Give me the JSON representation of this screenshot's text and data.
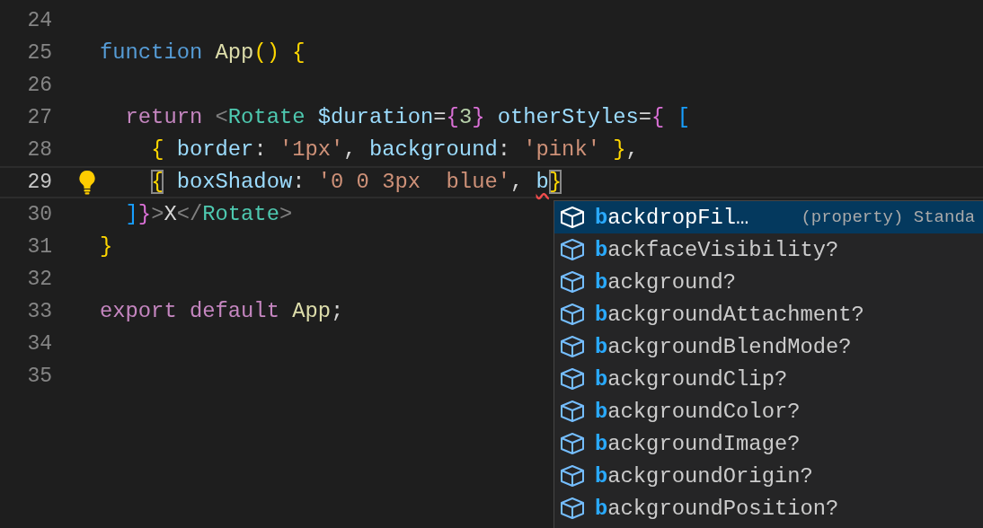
{
  "editor": {
    "lines": [
      {
        "number": "24",
        "current": false
      },
      {
        "number": "25",
        "current": false,
        "tokens": [
          {
            "kind": "keyword",
            "text": "function "
          },
          {
            "kind": "function",
            "text": "App"
          },
          {
            "kind": "bracket1",
            "text": "()"
          },
          {
            "kind": "bracket1",
            "text": " {"
          }
        ]
      },
      {
        "number": "26",
        "current": false
      },
      {
        "number": "27",
        "current": false,
        "tokens": [
          {
            "kind": "control",
            "text": "  return "
          },
          {
            "kind": "punct",
            "text": "<"
          },
          {
            "kind": "tag",
            "text": "Rotate"
          },
          {
            "kind": "attr",
            "text": " $duration"
          },
          {
            "kind": "plain",
            "text": "="
          },
          {
            "kind": "bracket2",
            "text": "{"
          },
          {
            "kind": "number",
            "text": "3"
          },
          {
            "kind": "bracket2",
            "text": "}"
          },
          {
            "kind": "attr",
            "text": " otherStyles"
          },
          {
            "kind": "plain",
            "text": "="
          },
          {
            "kind": "bracket2",
            "text": "{"
          },
          {
            "kind": "bracket3",
            "text": " ["
          }
        ]
      },
      {
        "number": "28",
        "current": false,
        "tokens": [
          {
            "kind": "bracket1",
            "text": "    {"
          },
          {
            "kind": "attr",
            "text": " border"
          },
          {
            "kind": "plain",
            "text": ": "
          },
          {
            "kind": "string",
            "text": "'1px'"
          },
          {
            "kind": "plain",
            "text": ", "
          },
          {
            "kind": "attr",
            "text": "background"
          },
          {
            "kind": "plain",
            "text": ": "
          },
          {
            "kind": "string",
            "text": "'pink'"
          },
          {
            "kind": "bracket1",
            "text": " }"
          },
          {
            "kind": "plain",
            "text": ","
          }
        ]
      },
      {
        "number": "29",
        "current": true,
        "tokens": [
          {
            "kind": "match",
            "text": "    {"
          },
          {
            "kind": "attr",
            "text": " boxShadow"
          },
          {
            "kind": "plain",
            "text": ": "
          },
          {
            "kind": "string",
            "text": "'0 0 3px  blue'"
          },
          {
            "kind": "plain",
            "text": ", "
          },
          {
            "kind": "error",
            "text": "b"
          },
          {
            "kind": "match",
            "text": "}"
          }
        ]
      },
      {
        "number": "30",
        "current": false,
        "tokens": [
          {
            "kind": "bracket3",
            "text": "  ]"
          },
          {
            "kind": "bracket2",
            "text": "}"
          },
          {
            "kind": "punct",
            "text": ">"
          },
          {
            "kind": "plain",
            "text": "X"
          },
          {
            "kind": "punct",
            "text": "</"
          },
          {
            "kind": "tag",
            "text": "Rotate"
          },
          {
            "kind": "punct",
            "text": ">"
          }
        ]
      },
      {
        "number": "31",
        "current": false,
        "tokens": [
          {
            "kind": "bracket1",
            "text": "}"
          }
        ]
      },
      {
        "number": "32",
        "current": false
      },
      {
        "number": "33",
        "current": false,
        "tokens": [
          {
            "kind": "control",
            "text": "export default "
          },
          {
            "kind": "function",
            "text": "App"
          },
          {
            "kind": "plain",
            "text": ";"
          }
        ]
      },
      {
        "number": "34",
        "current": false
      },
      {
        "number": "35",
        "current": false
      }
    ]
  },
  "suggestions": [
    {
      "match": "b",
      "rest": "ackdropFil…",
      "detail": "(property) Standa",
      "selected": true
    },
    {
      "match": "b",
      "rest": "ackfaceVisibility?",
      "selected": false
    },
    {
      "match": "b",
      "rest": "ackground?",
      "selected": false
    },
    {
      "match": "b",
      "rest": "ackgroundAttachment?",
      "selected": false
    },
    {
      "match": "b",
      "rest": "ackgroundBlendMode?",
      "selected": false
    },
    {
      "match": "b",
      "rest": "ackgroundClip?",
      "selected": false
    },
    {
      "match": "b",
      "rest": "ackgroundColor?",
      "selected": false
    },
    {
      "match": "b",
      "rest": "ackgroundImage?",
      "selected": false
    },
    {
      "match": "b",
      "rest": "ackgroundOrigin?",
      "selected": false
    },
    {
      "match": "b",
      "rest": "ackgroundPosition?",
      "selected": false
    }
  ]
}
